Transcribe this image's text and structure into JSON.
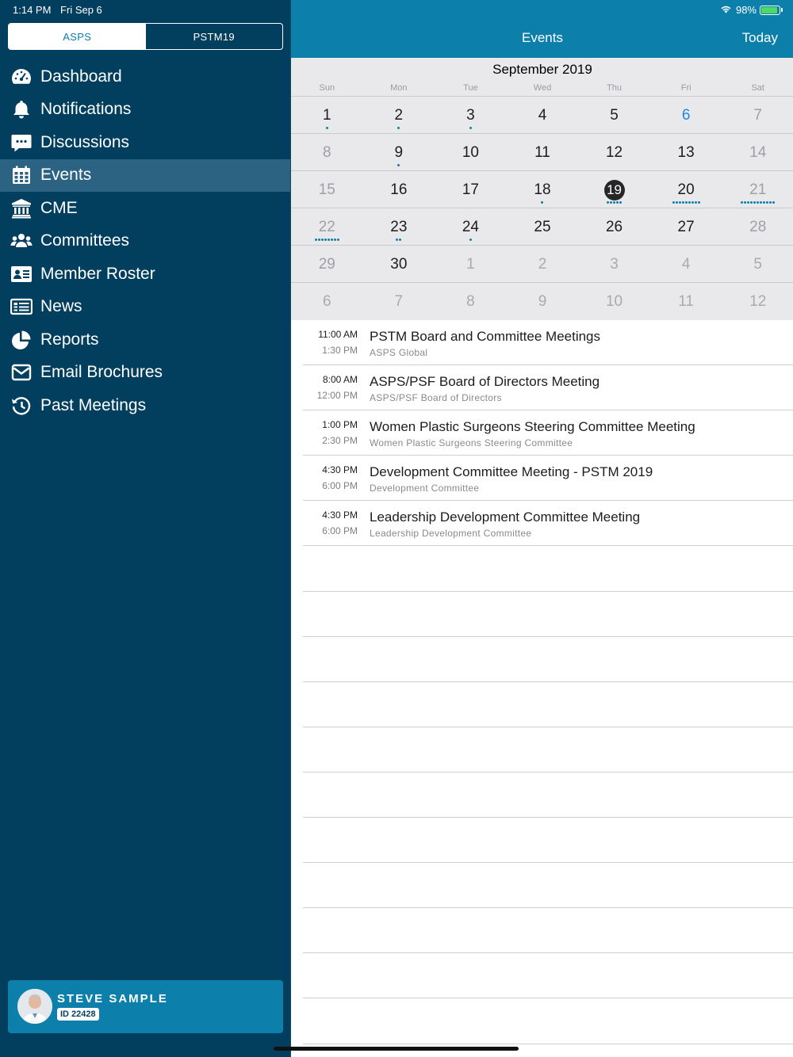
{
  "status": {
    "time": "1:14 PM",
    "date": "Fri Sep 6",
    "battery": "98%"
  },
  "sidebar": {
    "tabs": [
      {
        "label": "ASPS"
      },
      {
        "label": "PSTM19"
      }
    ],
    "items": [
      {
        "label": "Dashboard",
        "icon": "dashboard-icon"
      },
      {
        "label": "Notifications",
        "icon": "bell-icon"
      },
      {
        "label": "Discussions",
        "icon": "chat-icon"
      },
      {
        "label": "Events",
        "icon": "calendar-icon"
      },
      {
        "label": "CME",
        "icon": "institution-icon"
      },
      {
        "label": "Committees",
        "icon": "users-icon"
      },
      {
        "label": "Member Roster",
        "icon": "id-card-icon"
      },
      {
        "label": "News",
        "icon": "newspaper-icon"
      },
      {
        "label": "Reports",
        "icon": "pie-chart-icon"
      },
      {
        "label": "Email Brochures",
        "icon": "envelope-icon"
      },
      {
        "label": "Past Meetings",
        "icon": "history-icon"
      }
    ],
    "active_index": 3,
    "profile": {
      "name": "STEVE SAMPLE",
      "id": "ID 22428"
    }
  },
  "header": {
    "title": "Events",
    "today_label": "Today"
  },
  "calendar": {
    "month": "September 2019",
    "weekdays": [
      "Sun",
      "Mon",
      "Tue",
      "Wed",
      "Thu",
      "Fri",
      "Sat"
    ],
    "weeks": [
      [
        {
          "d": "1",
          "dots": 1
        },
        {
          "d": "2",
          "dots": 1
        },
        {
          "d": "3",
          "dots": 1
        },
        {
          "d": "4",
          "dots": 0
        },
        {
          "d": "5",
          "dots": 0
        },
        {
          "d": "6",
          "dots": 0,
          "state": "today"
        },
        {
          "d": "7",
          "dots": 0,
          "state": "weekend"
        }
      ],
      [
        {
          "d": "8",
          "dots": 0,
          "state": "weekend"
        },
        {
          "d": "9",
          "dots": 1
        },
        {
          "d": "10",
          "dots": 0
        },
        {
          "d": "11",
          "dots": 0
        },
        {
          "d": "12",
          "dots": 0
        },
        {
          "d": "13",
          "dots": 0
        },
        {
          "d": "14",
          "dots": 0,
          "state": "weekend"
        }
      ],
      [
        {
          "d": "15",
          "dots": 0,
          "state": "weekend"
        },
        {
          "d": "16",
          "dots": 0
        },
        {
          "d": "17",
          "dots": 0
        },
        {
          "d": "18",
          "dots": 1
        },
        {
          "d": "19",
          "dots": 5,
          "state": "selected"
        },
        {
          "d": "20",
          "dots": 9
        },
        {
          "d": "21",
          "dots": 11,
          "state": "weekend"
        }
      ],
      [
        {
          "d": "22",
          "dots": 8,
          "state": "weekend"
        },
        {
          "d": "23",
          "dots": 2
        },
        {
          "d": "24",
          "dots": 1
        },
        {
          "d": "25",
          "dots": 0
        },
        {
          "d": "26",
          "dots": 0
        },
        {
          "d": "27",
          "dots": 0
        },
        {
          "d": "28",
          "dots": 0,
          "state": "weekend"
        }
      ],
      [
        {
          "d": "29",
          "dots": 0,
          "state": "weekend"
        },
        {
          "d": "30",
          "dots": 0
        },
        {
          "d": "1",
          "dots": 0,
          "state": "other"
        },
        {
          "d": "2",
          "dots": 0,
          "state": "other"
        },
        {
          "d": "3",
          "dots": 0,
          "state": "other"
        },
        {
          "d": "4",
          "dots": 0,
          "state": "other"
        },
        {
          "d": "5",
          "dots": 0,
          "state": "other"
        }
      ],
      [
        {
          "d": "6",
          "dots": 0,
          "state": "other"
        },
        {
          "d": "7",
          "dots": 0,
          "state": "other"
        },
        {
          "d": "8",
          "dots": 0,
          "state": "other"
        },
        {
          "d": "9",
          "dots": 0,
          "state": "other"
        },
        {
          "d": "10",
          "dots": 0,
          "state": "other"
        },
        {
          "d": "11",
          "dots": 0,
          "state": "other"
        },
        {
          "d": "12",
          "dots": 0,
          "state": "other"
        }
      ]
    ]
  },
  "events": [
    {
      "start": "11:00 AM",
      "end": "1:30 PM",
      "title": "PSTM Board and Committee Meetings",
      "subtitle": "ASPS Global"
    },
    {
      "start": "8:00 AM",
      "end": "12:00 PM",
      "title": "ASPS/PSF Board of Directors Meeting",
      "subtitle": "ASPS/PSF Board of Directors"
    },
    {
      "start": "1:00 PM",
      "end": "2:30 PM",
      "title": "Women Plastic Surgeons Steering Committee Meeting",
      "subtitle": "Women Plastic Surgeons Steering Committee"
    },
    {
      "start": "4:30 PM",
      "end": "6:00 PM",
      "title": "Development Committee Meeting - PSTM 2019",
      "subtitle": "Development Committee"
    },
    {
      "start": "4:30 PM",
      "end": "6:00 PM",
      "title": "Leadership Development Committee Meeting",
      "subtitle": "Leadership Development Committee"
    }
  ],
  "colors": {
    "sidebar_bg": "#023f5f",
    "accent": "#0d7fab",
    "active_nav": "#2d6382",
    "today_text": "#1f86e6"
  }
}
